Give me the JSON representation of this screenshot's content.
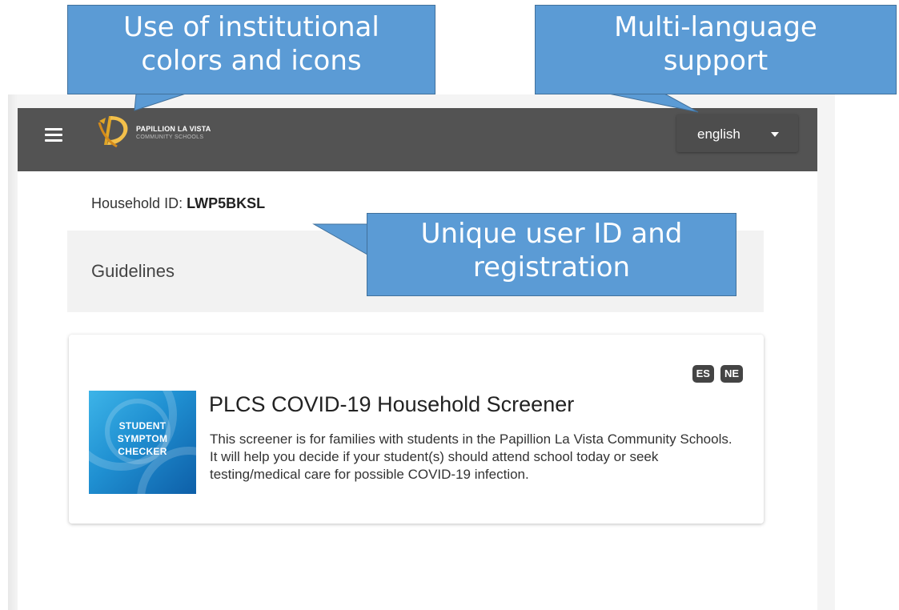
{
  "annotations": {
    "institutional": {
      "line1": "Use of institutional",
      "line2": "colors and icons"
    },
    "language": {
      "line1": "Multi-language",
      "line2": "support"
    },
    "user_id": {
      "line1": "Unique user ID and",
      "line2": "registration"
    }
  },
  "header": {
    "menu_icon": "hamburger-icon",
    "logo": {
      "line1": "PAPILLION LA VISTA",
      "line2": "COMMUNITY SCHOOLS"
    },
    "language_selector": {
      "value": "english",
      "icon": "caret-down-icon"
    }
  },
  "household": {
    "label": "Household ID:",
    "id": "LWP5BKSL"
  },
  "guidelines": {
    "label": "Guidelines"
  },
  "screener_card": {
    "language_badges": [
      "ES",
      "NE"
    ],
    "image": {
      "line1": "STUDENT",
      "line2": "SYMPTOM",
      "line3": "CHECKER"
    },
    "title": "PLCS COVID-19 Household Screener",
    "description": "This screener is for families with students in the Papillion La Vista Community Schools. It will help you decide if your student(s) should attend school today or seek testing/medical care for possible COVID-19 infection."
  },
  "colors": {
    "topbar": "#535353",
    "callout": "#5b9bd5",
    "callout_border": "#41719c",
    "logo_accent": "#e0a526",
    "badge": "#444444"
  }
}
